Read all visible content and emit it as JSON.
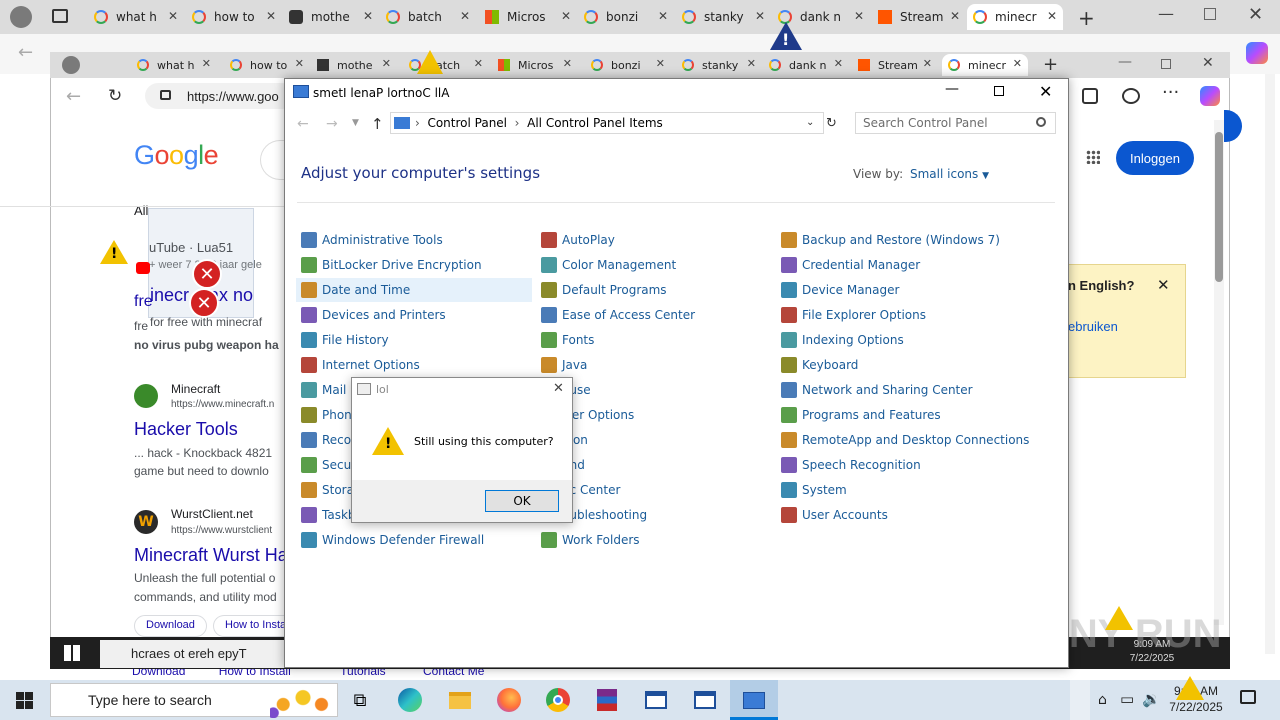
{
  "outer_tabs": [
    {
      "label": "what h",
      "icon": "google-icon"
    },
    {
      "label": "how to",
      "icon": "google-icon"
    },
    {
      "label": "mothe",
      "icon": "instructables-icon"
    },
    {
      "label": "batch",
      "icon": "google-icon"
    },
    {
      "label": "Micros",
      "icon": "microsoft-icon"
    },
    {
      "label": "bonzi",
      "icon": "google-icon"
    },
    {
      "label": "stanky",
      "icon": "google-icon"
    },
    {
      "label": "dank n",
      "icon": "google-icon"
    },
    {
      "label": "Stream",
      "icon": "soundcloud-icon"
    },
    {
      "label": "minecr",
      "icon": "google-icon"
    }
  ],
  "inner_tabs": [
    {
      "label": "what h"
    },
    {
      "label": "how to"
    },
    {
      "label": "mothe"
    },
    {
      "label": "batch"
    },
    {
      "label": "Micros"
    },
    {
      "label": "bonzi"
    },
    {
      "label": "stanky"
    },
    {
      "label": "dank n"
    },
    {
      "label": "Stream"
    },
    {
      "label": "minecr"
    }
  ],
  "browser": {
    "url": "https://www.goo",
    "login_button": "Inloggen",
    "google_logo": "Google",
    "all_tab": "All",
    "translate_popup_title": "n English?",
    "translate_popup_link": "ebruiken"
  },
  "results": {
    "yt_source": "uTube · Lua51",
    "yt_meta": "+ weer 7 2  ·  6 jaar gele",
    "yt_title": "inecr  max no",
    "yt_title_prefix": "fre",
    "yt_snip1": "for free with minecraf",
    "yt_snip1_prefix": "fre",
    "yt_snip2": "no virus pubg weapon ha",
    "mc_site": "Minecraft",
    "mc_url": "https://www.minecraft.n",
    "mc_title": "Hacker Tools",
    "mc_snip1": "... hack - Knockback 4821",
    "mc_snip2": "game but need to downlo",
    "wc_site": "WurstClient.net",
    "wc_url": "https://www.wurstclient",
    "wc_title": "Minecraft Wurst Ha",
    "wc_snip1": "Unleash the full potential o",
    "wc_snip2": "commands, and utility mod",
    "chip1": "Download",
    "chip2": "How to Insta",
    "bottom_links": [
      "Download",
      "How to Install",
      "Tutorials",
      "Contact Me"
    ]
  },
  "control_panel": {
    "title": "smetI lenaP lortnoC llA",
    "breadcrumb": [
      "Control Panel",
      "All Control Panel Items"
    ],
    "search_placeholder": "Search Control Panel",
    "heading": "Adjust your computer's settings",
    "view_by_label": "View by:",
    "view_by_value": "Small icons",
    "col1": [
      "Administrative Tools",
      "BitLocker Drive Encryption",
      "Date and Time",
      "Devices and Printers",
      "File History",
      "Internet Options",
      "Mail (",
      "Phone",
      "Recov",
      "Secur",
      "Storag",
      "Taskb",
      "Windows Defender Firewall"
    ],
    "col2": [
      "AutoPlay",
      "Color Management",
      "Default Programs",
      "Ease of Access Center",
      "Fonts",
      "Java",
      "ouse",
      "wer Options",
      "gion",
      "und",
      "nc Center",
      "oubleshooting",
      "Work Folders"
    ],
    "col3": [
      "Backup and Restore (Windows 7)",
      "Credential Manager",
      "Device Manager",
      "File Explorer Options",
      "Indexing Options",
      "Keyboard",
      "Network and Sharing Center",
      "Programs and Features",
      "RemoteApp and Desktop Connections",
      "Speech Recognition",
      "System",
      "User Accounts"
    ]
  },
  "dialog": {
    "title": "lol",
    "message": "Still using this computer?",
    "ok": "OK"
  },
  "inner_taskbar": {
    "search": "hcraes ot ereh epyT",
    "time": "9:09 AM",
    "date": "7/22/2025"
  },
  "taskbar": {
    "search": "Type here to search",
    "time": "9:09 AM",
    "date": "7/22/2025"
  },
  "watermark": "ANY RUN"
}
